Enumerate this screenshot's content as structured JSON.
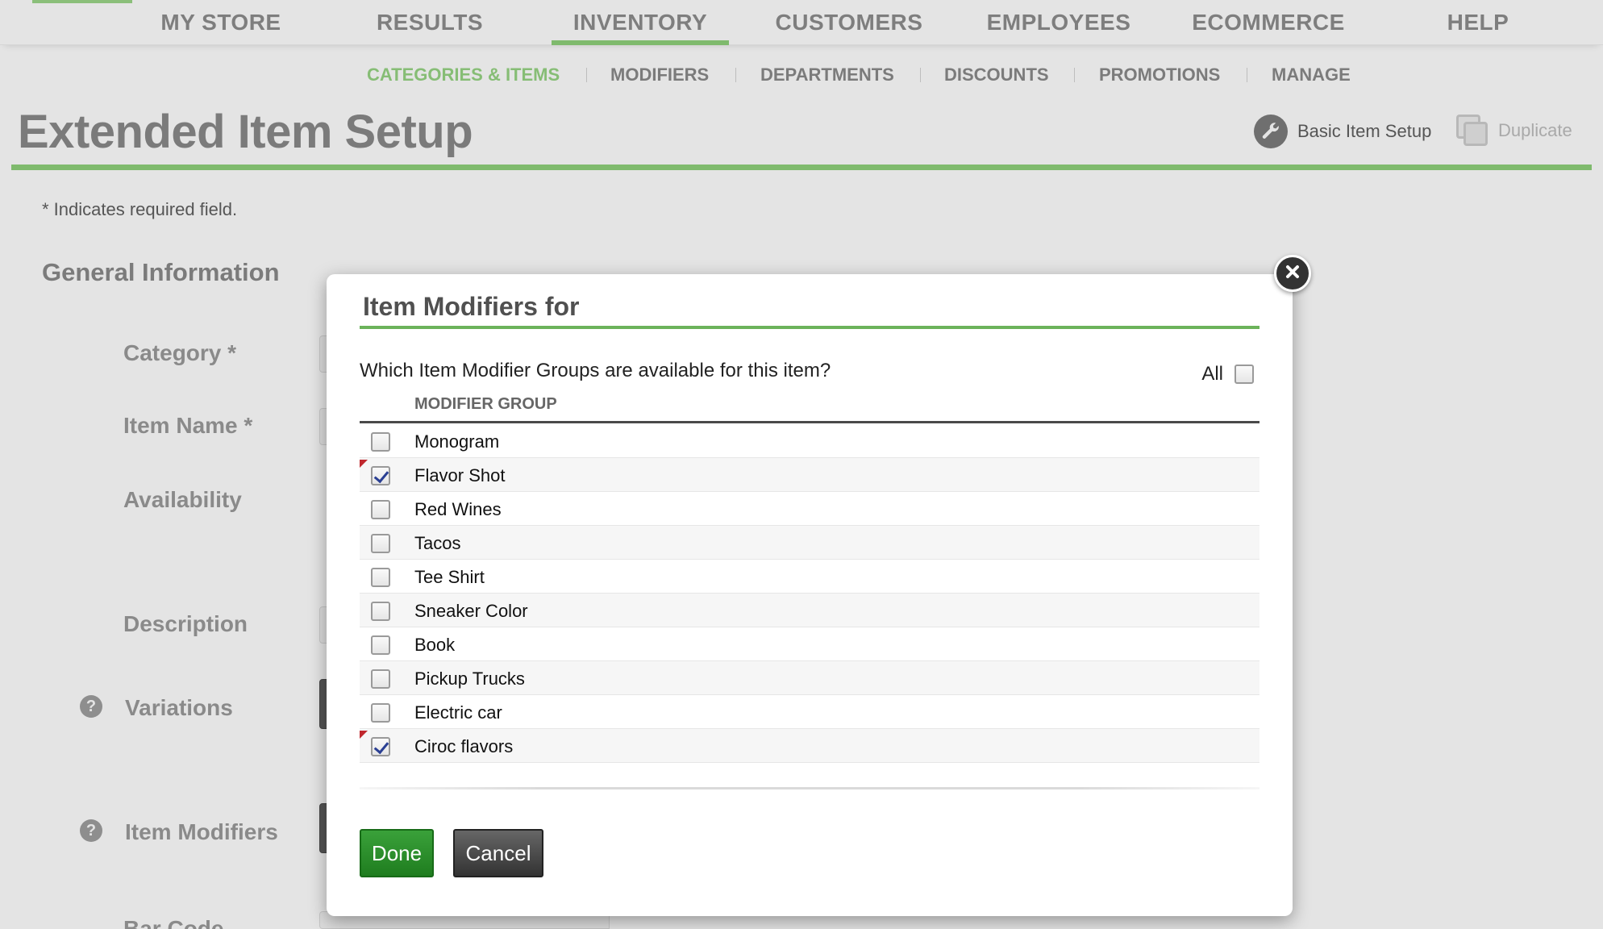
{
  "main_nav": {
    "items": [
      {
        "label": "MY STORE"
      },
      {
        "label": "RESULTS"
      },
      {
        "label": "INVENTORY",
        "active": true
      },
      {
        "label": "CUSTOMERS"
      },
      {
        "label": "EMPLOYEES"
      },
      {
        "label": "ECOMMERCE"
      },
      {
        "label": "HELP"
      }
    ]
  },
  "sub_nav": {
    "items": [
      {
        "label": "CATEGORIES & ITEMS",
        "active": true
      },
      {
        "label": "MODIFIERS"
      },
      {
        "label": "DEPARTMENTS"
      },
      {
        "label": "DISCOUNTS"
      },
      {
        "label": "PROMOTIONS"
      },
      {
        "label": "MANAGE"
      }
    ]
  },
  "header": {
    "title": "Extended Item Setup",
    "basic_setup_label": "Basic Item Setup",
    "duplicate_label": "Duplicate"
  },
  "form": {
    "required_note": "* Indicates required field.",
    "section_title": "General Information",
    "labels": {
      "category": "Category *",
      "item_name": "Item Name *",
      "availability": "Availability",
      "description": "Description",
      "variations": "Variations",
      "item_modifiers": "Item Modifiers",
      "bar_code": "Bar Code"
    }
  },
  "modal": {
    "title": "Item Modifiers for",
    "question": "Which Item Modifier Groups are available for this item?",
    "all_label": "All",
    "all_checked": false,
    "column_header": "MODIFIER GROUP",
    "groups": [
      {
        "name": "Monogram",
        "checked": false
      },
      {
        "name": "Flavor Shot",
        "checked": true
      },
      {
        "name": "Red Wines",
        "checked": false
      },
      {
        "name": "Tacos",
        "checked": false
      },
      {
        "name": "Tee Shirt",
        "checked": false
      },
      {
        "name": "Sneaker Color",
        "checked": false
      },
      {
        "name": "Book",
        "checked": false
      },
      {
        "name": "Pickup Trucks",
        "checked": false
      },
      {
        "name": "Electric car",
        "checked": false
      },
      {
        "name": "Ciroc flavors",
        "checked": true
      }
    ],
    "done_label": "Done",
    "cancel_label": "Cancel"
  },
  "colors": {
    "accent_green": "#7fba6d",
    "done_green": "#2a8f2a",
    "changed_marker": "#c0272d"
  }
}
